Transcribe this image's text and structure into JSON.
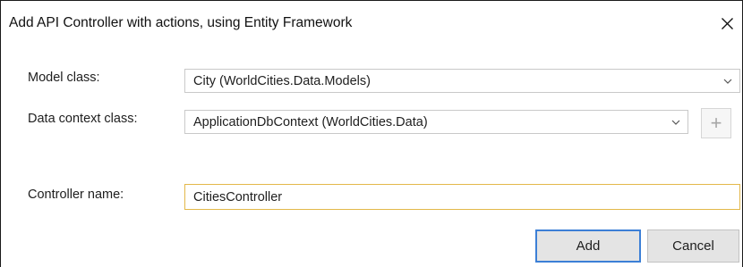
{
  "dialog": {
    "title": "Add API Controller with actions, using Entity Framework",
    "close_icon": "close-icon"
  },
  "form": {
    "model_class": {
      "label": "Model class:",
      "value": "City (WorldCities.Data.Models)"
    },
    "data_context_class": {
      "label": "Data context class:",
      "value": "ApplicationDbContext (WorldCities.Data)",
      "add_button_label": "+"
    },
    "controller_name": {
      "label": "Controller name:",
      "value": "CitiesController"
    }
  },
  "buttons": {
    "add_label": "Add",
    "cancel_label": "Cancel"
  },
  "colors": {
    "focus_border": "#e3b84a",
    "default_button_border": "#3c7fd6"
  }
}
